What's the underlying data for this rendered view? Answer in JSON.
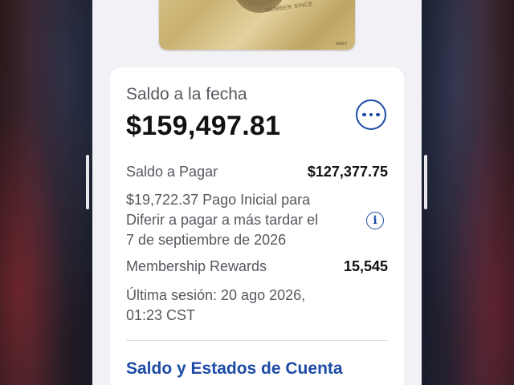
{
  "card": {
    "emblem_text": "MEMBER SINCE",
    "small_logo_text": "AMEX"
  },
  "account": {
    "balance_label": "Saldo a la fecha",
    "balance_value": "$159,497.81",
    "more_icon": "more-ellipsis-icon",
    "payment_label": "Saldo a Pagar",
    "payment_value": "$127,377.75",
    "deferral_line1": "$19,722.37 Pago Inicial para",
    "deferral_line2": "Diferir a pagar a más tardar el",
    "deferral_line3": "7 de septiembre de 2026",
    "info_icon": "info-icon",
    "rewards_label": "Membership Rewards",
    "rewards_value": "15,545",
    "session_line1": "Última sesión: 20 ago 2026,",
    "session_line2": "01:23 CST",
    "statements_link": "Saldo y Estados de Cuenta"
  },
  "colors": {
    "accent": "#1c4ca5",
    "panel_bg": "#ffffff",
    "screen_bg": "#f2f2f6",
    "text_primary": "#111111",
    "text_secondary": "#55585e"
  }
}
